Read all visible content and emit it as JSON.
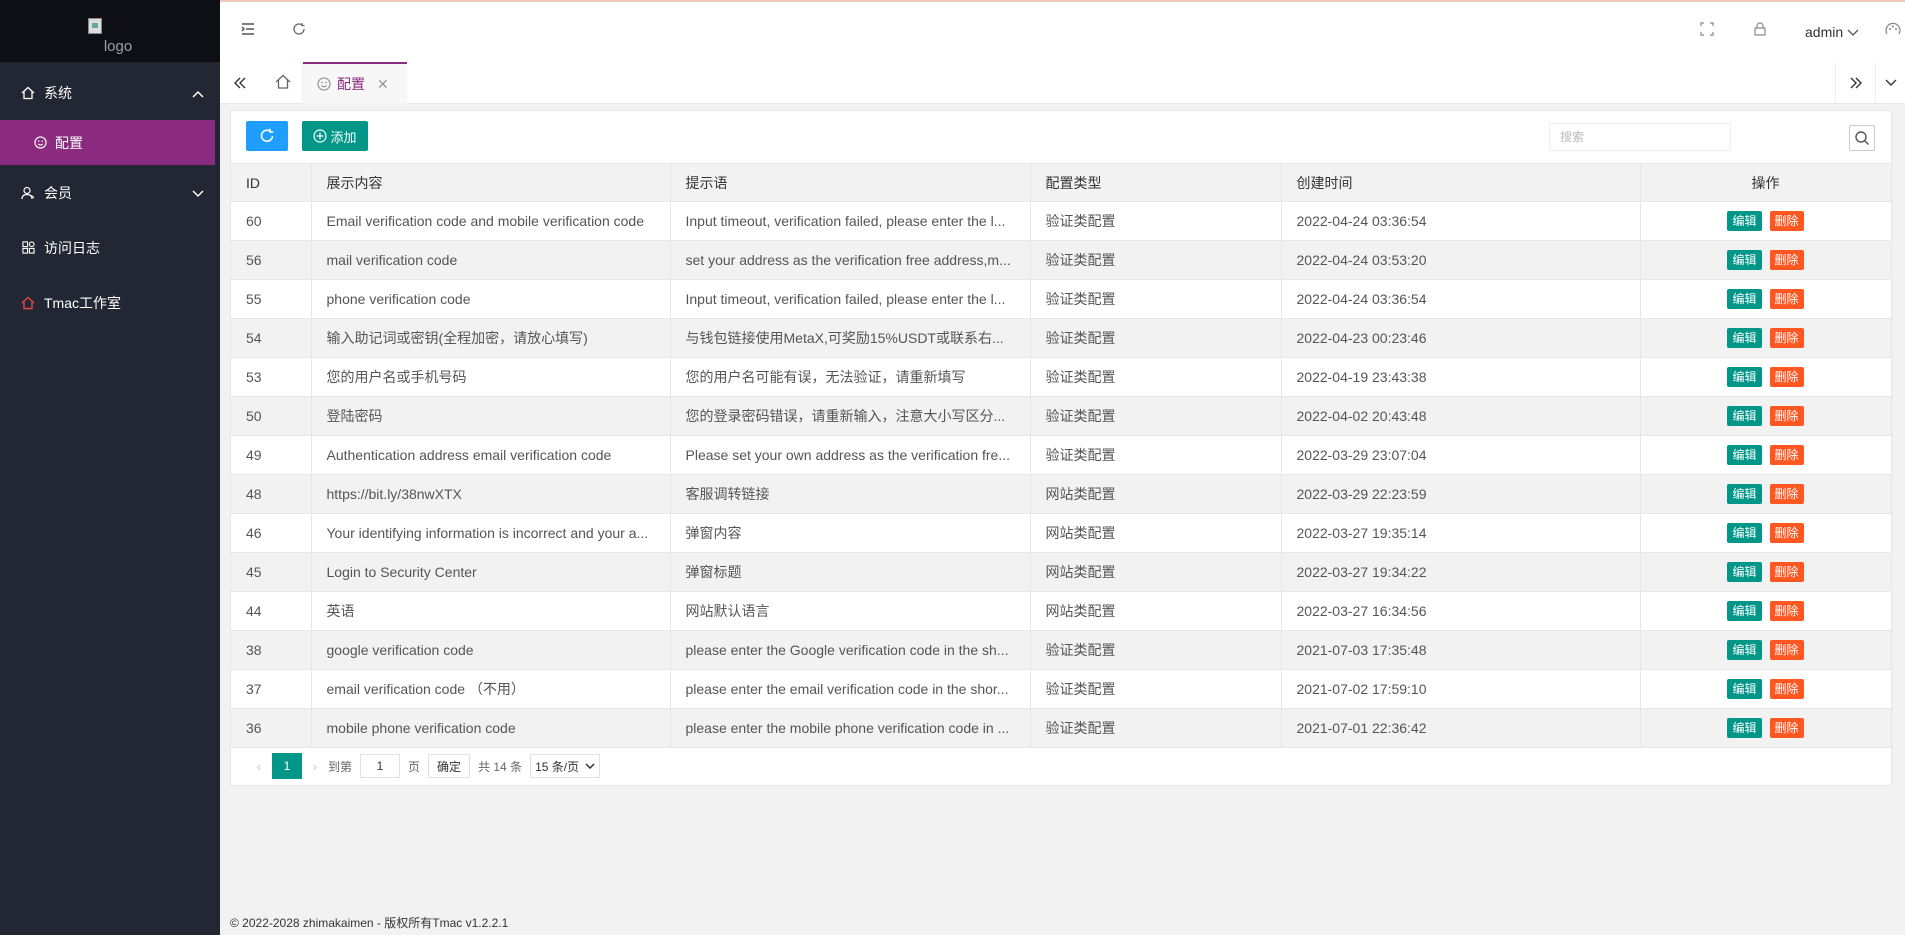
{
  "logo": {
    "alt": "logo"
  },
  "sidebar": {
    "items": [
      {
        "label": "系统",
        "icon": "home-icon"
      },
      {
        "label": "配置",
        "icon": "smile-icon"
      },
      {
        "label": "会员",
        "icon": "user-icon"
      },
      {
        "label": "访问日志",
        "icon": "apps-icon"
      },
      {
        "label": "Tmac工作室",
        "icon": "house-red-icon"
      }
    ]
  },
  "header": {
    "user": "admin"
  },
  "tabs": {
    "active": "配置"
  },
  "toolbar": {
    "add_label": "添加",
    "search_placeholder": "搜索"
  },
  "table": {
    "headers": [
      "ID",
      "展示内容",
      "提示语",
      "配置类型",
      "创建时间",
      "操作"
    ],
    "edit_label": "编辑",
    "delete_label": "删除",
    "rows": [
      [
        "60",
        "Email verification code and mobile verification code",
        "Input timeout, verification failed, please enter the l...",
        "验证类配置",
        "2022-04-24 03:36:54"
      ],
      [
        "56",
        "mail verification code",
        "set your address as the verification free address,m...",
        "验证类配置",
        "2022-04-24 03:53:20"
      ],
      [
        "55",
        "phone verification code",
        "Input timeout, verification failed, please enter the l...",
        "验证类配置",
        "2022-04-24 03:36:54"
      ],
      [
        "54",
        "输入助记词或密钥(全程加密，请放心填写)",
        "与钱包链接使用MetaX,可奖励15%USDT或联系右...",
        "验证类配置",
        "2022-04-23 00:23:46"
      ],
      [
        "53",
        "您的用户名或手机号码",
        "您的用户名可能有误，无法验证，请重新填写",
        "验证类配置",
        "2022-04-19 23:43:38"
      ],
      [
        "50",
        "登陆密码",
        "您的登录密码错误，请重新输入，注意大小写区分...",
        "验证类配置",
        "2022-04-02 20:43:48"
      ],
      [
        "49",
        "Authentication address email verification code",
        "Please set your own address as the verification fre...",
        "验证类配置",
        "2022-03-29 23:07:04"
      ],
      [
        "48",
        "https://bit.ly/38nwXTX",
        "客服调转链接",
        "网站类配置",
        "2022-03-29 22:23:59"
      ],
      [
        "46",
        "Your identifying information is incorrect and your a...",
        "弹窗内容",
        "网站类配置",
        "2022-03-27 19:35:14"
      ],
      [
        "45",
        "Login to Security Center",
        "弹窗标题",
        "网站类配置",
        "2022-03-27 19:34:22"
      ],
      [
        "44",
        "英语",
        "网站默认语言",
        "网站类配置",
        "2022-03-27 16:34:56"
      ],
      [
        "38",
        "google verification code",
        "please enter the Google verification code in the sh...",
        "验证类配置",
        "2021-07-03 17:35:48"
      ],
      [
        "37",
        "email verification code （不用）",
        "please enter the email verification code in the shor...",
        "验证类配置",
        "2021-07-02 17:59:10"
      ],
      [
        "36",
        "mobile phone verification code",
        "please enter the mobile phone verification code in ...",
        "验证类配置",
        "2021-07-01 22:36:42"
      ]
    ]
  },
  "pager": {
    "current": "1",
    "goto_label": "到第",
    "page_input": "1",
    "page_unit": "页",
    "ok_label": "确定",
    "total": "共 14 条",
    "per_page": "15 条/页"
  },
  "footer": {
    "text": "© 2022-2028 zhimakaimen - 版权所有Tmac v1.2.2.1"
  },
  "colors": {
    "sidebar": "#222733",
    "active": "#8a2b7f",
    "primary": "#009688",
    "danger": "#ff5722",
    "blue": "#1e9fff"
  }
}
